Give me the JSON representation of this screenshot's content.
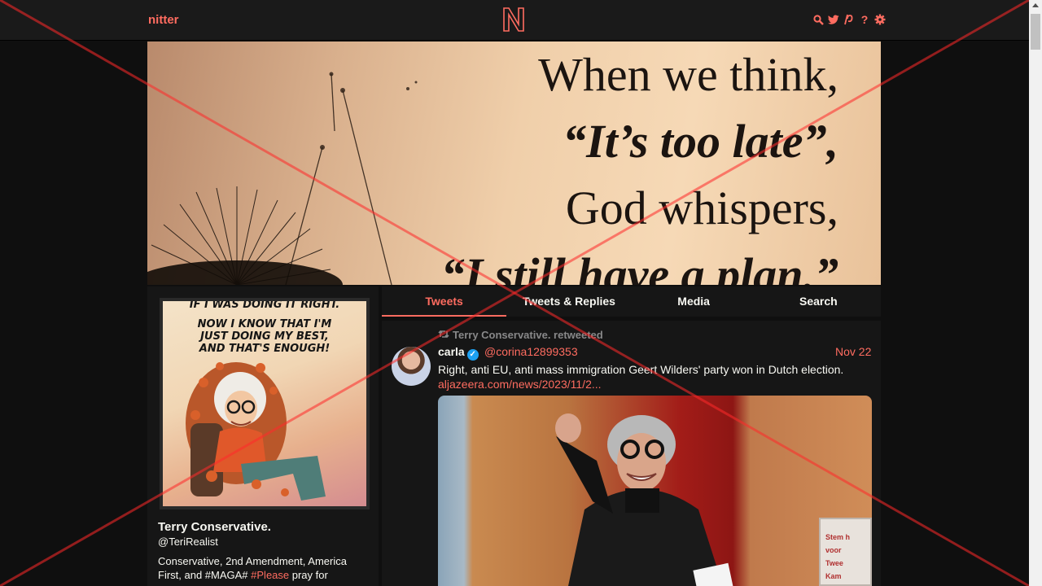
{
  "navbar": {
    "brand": "nitter",
    "logo_letter": "N",
    "icons": [
      "search-icon",
      "twitter-bird-icon",
      "rss-icon",
      "help-icon",
      "settings-icon"
    ]
  },
  "banner": {
    "lines": [
      "When we think,",
      "“It’s too late”,",
      "God whispers,",
      "“I still have a plan.”"
    ]
  },
  "profile": {
    "comic_lines": [
      "IF I WAS DOING IT RIGHT.",
      "NOW I KNOW THAT I'M",
      "JUST DOING MY BEST,",
      "AND THAT'S ENOUGH!"
    ],
    "name": "Terry Conservative.",
    "handle": "@TeriRealist",
    "bio_part1": "Conservative, 2nd Amendment, America First, and #MAGA# ",
    "bio_hashtag": "#Please",
    "bio_part2": " pray for"
  },
  "tabs": [
    {
      "label": "Tweets",
      "active": true
    },
    {
      "label": "Tweets & Replies",
      "active": false
    },
    {
      "label": "Media",
      "active": false
    },
    {
      "label": "Search",
      "active": false
    }
  ],
  "tweet": {
    "retweet_label": "Terry Conservative. retweeted",
    "author_name": "carla",
    "author_handle": "@corina12899353",
    "date": "Nov 22",
    "text": "Right, anti EU, anti mass immigration Geert Wilders' party won in Dutch election.",
    "link": "aljazeera.com/news/2023/11/2...",
    "media_sign_lines": [
      "Stem h",
      "voor",
      "Twee",
      "Kam"
    ]
  },
  "colors": {
    "accent": "#ff6c60",
    "background": "#0f0f0f",
    "panel": "#161616",
    "navbar": "#1a1a1a",
    "verified": "#1da1f2"
  }
}
